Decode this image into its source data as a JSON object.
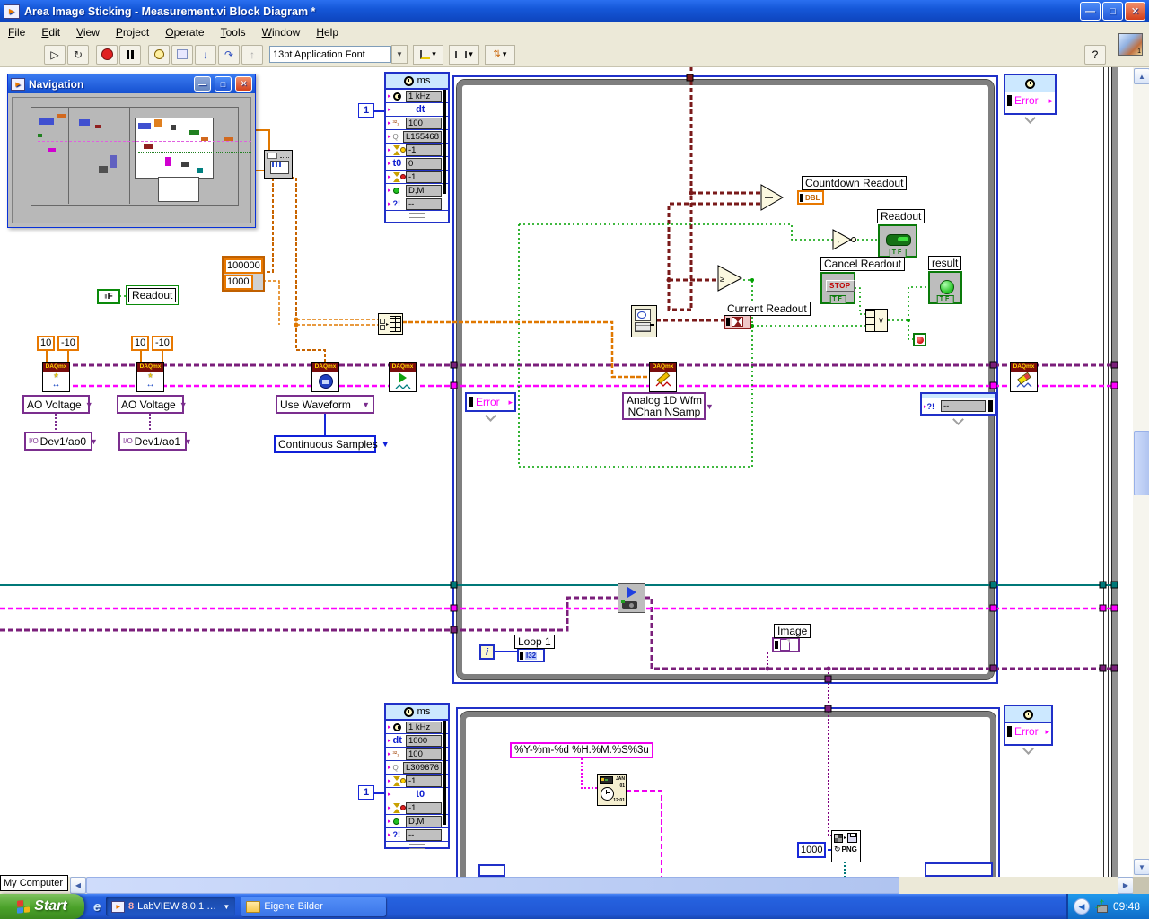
{
  "titlebar": {
    "title": "Area Image Sticking - Measurement.vi Block Diagram *"
  },
  "menu": {
    "items": [
      "File",
      "Edit",
      "View",
      "Project",
      "Operate",
      "Tools",
      "Window",
      "Help"
    ]
  },
  "toolbar": {
    "font": "13pt Application Font"
  },
  "navigation": {
    "title": "Navigation"
  },
  "vi_icon_badge": "1",
  "timed_top": {
    "header": "ms",
    "clk": "1 kHz",
    "dt": "dt",
    "iter": "100",
    "name": "L155468",
    "to1": "-1",
    "t0": "t0",
    "t0v": "0",
    "to2": "-1",
    "mode": "D,M",
    "q": "?!",
    "qv": "--",
    "error": "Error"
  },
  "timed_bottom": {
    "header": "ms",
    "clk": "1 kHz",
    "dt": "dt",
    "dtv": "1000",
    "iter": "100",
    "name": "L309676",
    "to1": "-1",
    "t0": "t0",
    "to2": "-1",
    "mode": "D,M",
    "q": "?!",
    "qv": "--",
    "error": "Error"
  },
  "inner": {
    "error": "Error",
    "q": "?!",
    "qv": "--"
  },
  "daqmx": "DAQmx",
  "constants": {
    "one": "1",
    "ten": "10",
    "minus_ten": "-10",
    "arr_top": "100000",
    "arr_bot": "1000",
    "thousand": "1000"
  },
  "dropdowns": {
    "ao": "AO Voltage",
    "dev0": "Dev1/ao0",
    "dev1": "Dev1/ao1",
    "wave": "Use Waveform",
    "cont": "Continuous Samples",
    "analog1": "Analog 1D Wfm",
    "analog2": "NChan NSamp"
  },
  "labels": {
    "countdown": "Countdown Readout",
    "readout": "Readout",
    "cancel": "Cancel Readout",
    "result": "result",
    "current": "Current Readout",
    "loop1": "Loop 1",
    "image": "Image",
    "readout_var": "Readout"
  },
  "terminals": {
    "dbl": "DBL",
    "i32": "I32",
    "stop": "STOP",
    "tf": "TF",
    "png": "PNG",
    "iter": "i",
    "f": "F",
    "or": "v"
  },
  "string_constant": "%Y-%m-%d %H.%M.%S%3u",
  "fmt_icon": {
    "month": "JAN",
    "day": "01",
    "clock": "12:01"
  },
  "statusbar": {
    "target": "My Computer"
  },
  "taskbar": {
    "start": "Start",
    "task1_count": "8",
    "task1": "LabVIEW 8.0.1 D...",
    "task2": "Eigene Bilder",
    "time": "09:48"
  }
}
